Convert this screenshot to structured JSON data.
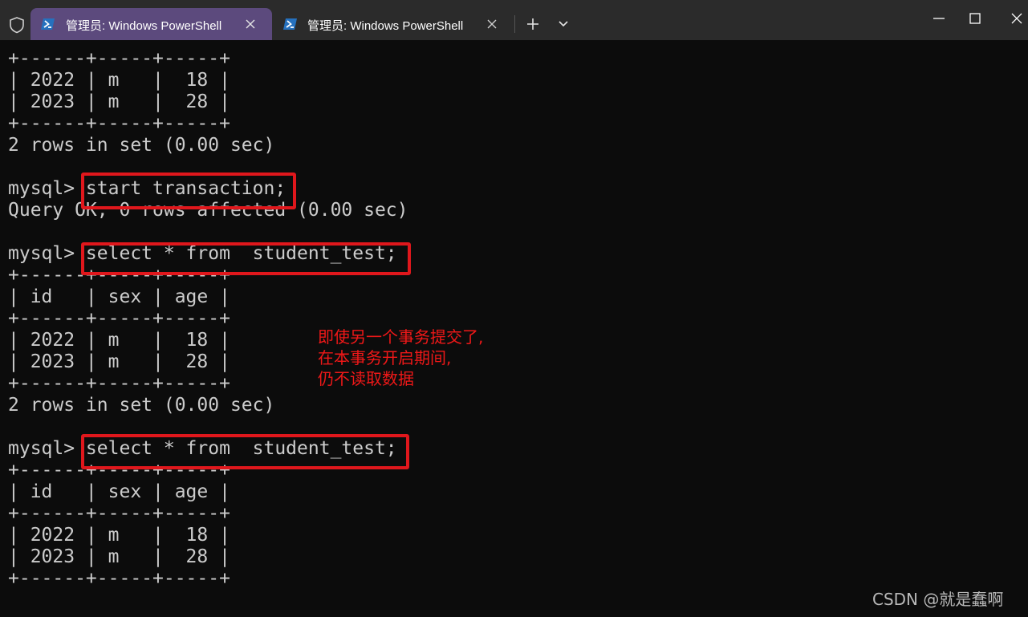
{
  "tabs": [
    {
      "title": "管理员: Windows PowerShell",
      "active": true
    },
    {
      "title": "管理员: Windows PowerShell",
      "active": false
    }
  ],
  "colors": {
    "titlebar": "#2b2b2b",
    "active_tab": "#5c4a7d",
    "terminal_bg": "#0c0c0c",
    "terminal_text": "#cccccc",
    "highlight": "#e0171c",
    "annotation": "#f01818"
  },
  "terminal": {
    "lines": [
      "+------+-----+-----+",
      "| 2022 | m   |  18 |",
      "| 2023 | m   |  28 |",
      "+------+-----+-----+",
      "2 rows in set (0.00 sec)",
      "",
      "mysql> start transaction;",
      "Query OK, 0 rows affected (0.00 sec)",
      "",
      "mysql> select * from  student_test;",
      "+------+-----+-----+",
      "| id   | sex | age |",
      "+------+-----+-----+",
      "| 2022 | m   |  18 |",
      "| 2023 | m   |  28 |",
      "+------+-----+-----+",
      "2 rows in set (0.00 sec)",
      "",
      "mysql> select * from  student_test;",
      "+------+-----+-----+",
      "| id   | sex | age |",
      "+------+-----+-----+",
      "| 2022 | m   |  18 |",
      "| 2023 | m   |  28 |",
      "+------+-----+-----+"
    ]
  },
  "annotation": {
    "lines": [
      "即使另一个事务提交了,",
      "在本事务开启期间,",
      "仍不读取数据"
    ]
  },
  "watermark": "CSDN @就是蠢啊"
}
